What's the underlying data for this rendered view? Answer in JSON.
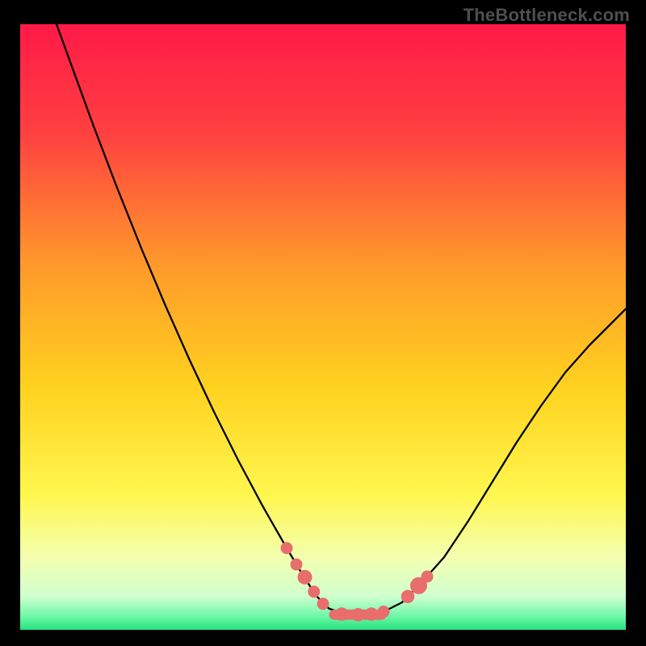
{
  "attribution": "TheBottleneck.com",
  "chart_data": {
    "type": "line",
    "title": "",
    "xlabel": "",
    "ylabel": "",
    "xlim": [
      0,
      100
    ],
    "ylim": [
      0,
      100
    ],
    "grid": false,
    "legend": false,
    "gradient_stops": [
      {
        "offset": 0.0,
        "color": "#ff1a48"
      },
      {
        "offset": 0.18,
        "color": "#ff4040"
      },
      {
        "offset": 0.4,
        "color": "#ff9a2a"
      },
      {
        "offset": 0.6,
        "color": "#ffd21f"
      },
      {
        "offset": 0.78,
        "color": "#fff750"
      },
      {
        "offset": 0.88,
        "color": "#f3ffb0"
      },
      {
        "offset": 0.945,
        "color": "#d0ffce"
      },
      {
        "offset": 0.978,
        "color": "#6cf7a7"
      },
      {
        "offset": 1.0,
        "color": "#25e27d"
      }
    ],
    "series": [
      {
        "name": "curve",
        "x": [
          6.0,
          8.0,
          12.0,
          16.0,
          20.0,
          24.0,
          28.0,
          32.0,
          36.0,
          40.0,
          44.0,
          47.0,
          49.0,
          51.0,
          54.0,
          58.0,
          60.0,
          63.0,
          66.0,
          70.0,
          74.0,
          78.0,
          82.0,
          86.0,
          90.0,
          94.0,
          98.0,
          100.0
        ],
        "y": [
          100.0,
          94.5,
          83.5,
          73.0,
          63.0,
          53.5,
          44.5,
          36.0,
          28.0,
          20.5,
          13.5,
          8.5,
          5.5,
          3.5,
          2.5,
          2.5,
          3.0,
          4.5,
          7.5,
          12.0,
          18.0,
          24.5,
          31.0,
          37.0,
          42.5,
          47.0,
          51.0,
          53.0
        ]
      }
    ],
    "markers": [
      {
        "x": 44.0,
        "y": 13.5,
        "r": 1.0
      },
      {
        "x": 45.6,
        "y": 10.8,
        "r": 1.0
      },
      {
        "x": 47.0,
        "y": 8.7,
        "r": 1.2
      },
      {
        "x": 48.5,
        "y": 6.3,
        "r": 1.0
      },
      {
        "x": 50.0,
        "y": 4.3,
        "r": 1.0
      },
      {
        "x": 53.1,
        "y": 2.6,
        "r": 1.1
      },
      {
        "x": 55.8,
        "y": 2.5,
        "r": 1.1
      },
      {
        "x": 58.0,
        "y": 2.6,
        "r": 1.1
      },
      {
        "x": 60.0,
        "y": 3.0,
        "r": 1.0
      },
      {
        "x": 64.0,
        "y": 5.5,
        "r": 1.1
      },
      {
        "x": 65.8,
        "y": 7.3,
        "r": 1.4
      },
      {
        "x": 67.2,
        "y": 8.8,
        "r": 1.0
      }
    ],
    "marker_color": "#e86d6d",
    "baseline_bar": {
      "y": 2.5,
      "x_start": 51.0,
      "x_end": 60.5,
      "height": 1.7,
      "color": "#e86d6d"
    }
  }
}
